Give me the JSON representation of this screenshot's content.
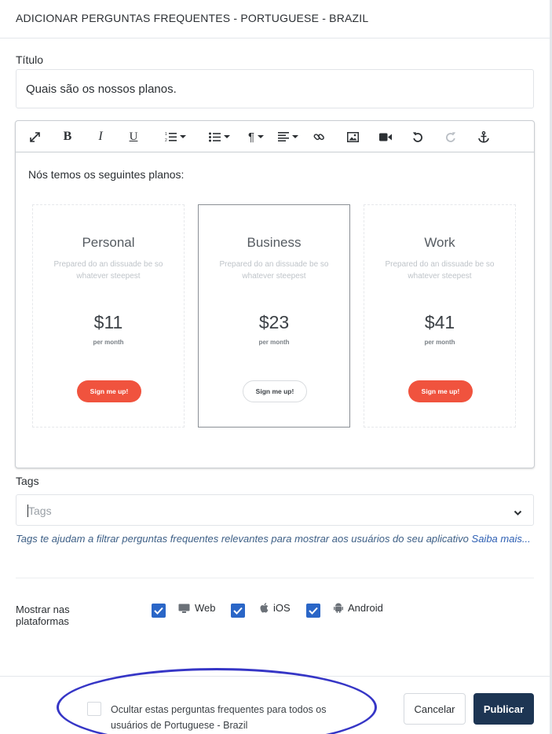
{
  "header": {
    "title": "ADICIONAR PERGUNTAS FREQUENTES - PORTUGUESE - BRAZIL"
  },
  "form": {
    "title_label": "Título",
    "title_value": "Quais são os nossos planos.",
    "tags_label": "Tags",
    "tags_placeholder": "Tags",
    "tags_help": "Tags te ajudam a filtrar perguntas frequentes relevantes para mostrar aos usuários do seu aplicativo",
    "tags_help_link": "Saiba mais...",
    "platforms_label": "Mostrar nas plataformas"
  },
  "toolbar": {
    "bold": "B",
    "italic": "I",
    "underline": "U",
    "icons": [
      "expand-icon",
      "bold-icon",
      "italic-icon",
      "underline-icon",
      "ordered-list-icon",
      "unordered-list-icon",
      "paragraph-icon",
      "align-icon",
      "link-icon",
      "image-icon",
      "video-icon",
      "undo-icon",
      "redo-icon",
      "anchor-icon"
    ]
  },
  "editor": {
    "intro": "Nós temos os seguintes planos:",
    "plans": [
      {
        "name": "Personal",
        "desc": "Prepared do an dissuade be so whatever steepest",
        "price": "$11",
        "period": "per month",
        "button": "Sign me up!",
        "featured": false
      },
      {
        "name": "Business",
        "desc": "Prepared do an dissuade be so whatever steepest",
        "price": "$23",
        "period": "per month",
        "button": "Sign me up!",
        "featured": true
      },
      {
        "name": "Work",
        "desc": "Prepared do an dissuade be so whatever steepest",
        "price": "$41",
        "period": "per month",
        "button": "Sign me up!",
        "featured": false
      }
    ]
  },
  "platforms": [
    {
      "label": "Web",
      "checked": true,
      "icon": "monitor-icon"
    },
    {
      "label": "iOS",
      "checked": true,
      "icon": "apple-icon"
    },
    {
      "label": "Android",
      "checked": true,
      "icon": "android-icon"
    }
  ],
  "footer": {
    "hide_label": "Ocultar estas perguntas frequentes para todos os usuários de Portuguese - Brazil",
    "hide_checked": false,
    "cancel": "Cancelar",
    "publish": "Publicar"
  },
  "colors": {
    "accent": "#2a66c7",
    "primary_button": "#1d3553",
    "cta_red": "#f0533e",
    "annotation": "#3636c6"
  }
}
